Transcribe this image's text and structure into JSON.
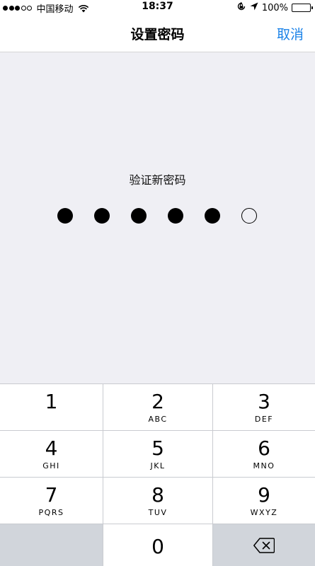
{
  "status_bar": {
    "carrier": "中国移动",
    "time": "18:37",
    "battery_percent": "100%",
    "signal_bars_filled": 3,
    "signal_bars_total": 5,
    "icons": [
      "wifi-icon",
      "rotation-lock-icon",
      "location-arrow-icon",
      "battery-icon"
    ]
  },
  "nav": {
    "title": "设置密码",
    "cancel_label": "取消"
  },
  "passcode": {
    "prompt": "验证新密码",
    "filled_count": 5,
    "total_count": 6
  },
  "keypad": {
    "keys": [
      {
        "digit": "1",
        "letters": ""
      },
      {
        "digit": "2",
        "letters": "ABC"
      },
      {
        "digit": "3",
        "letters": "DEF"
      },
      {
        "digit": "4",
        "letters": "GHI"
      },
      {
        "digit": "5",
        "letters": "JKL"
      },
      {
        "digit": "6",
        "letters": "MNO"
      },
      {
        "digit": "7",
        "letters": "PQRS"
      },
      {
        "digit": "8",
        "letters": "TUV"
      },
      {
        "digit": "9",
        "letters": "WXYZ"
      },
      {
        "digit": "0",
        "letters": ""
      }
    ],
    "delete_icon": "backspace-icon"
  },
  "colors": {
    "accent": "#1a82e8",
    "content_bg": "#efeff4",
    "key_bg": "#ffffff",
    "dim_key_bg": "#d1d5db"
  }
}
